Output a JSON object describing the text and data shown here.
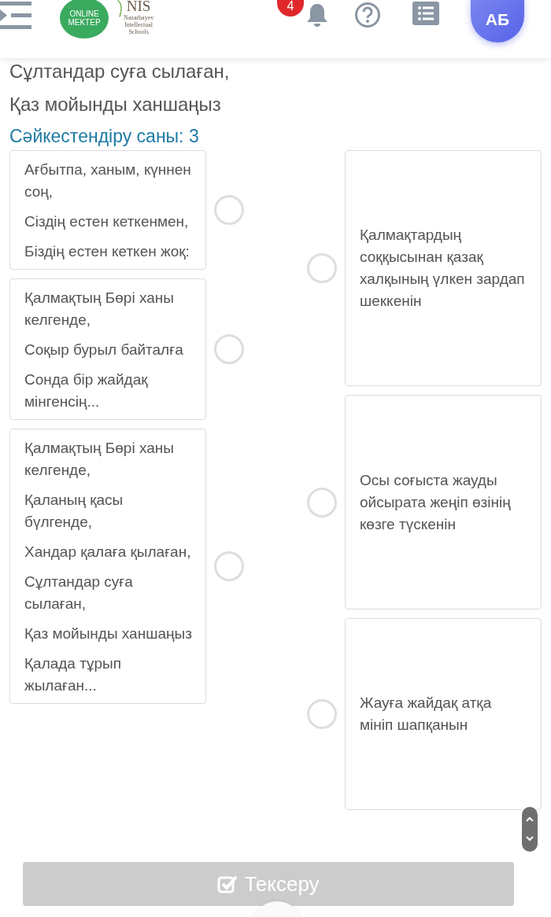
{
  "header": {
    "logo": {
      "line_1": "ONLINE",
      "line_2": "MEKTEP"
    },
    "school_logo": {
      "abbr": "NIS",
      "lines": [
        "Nazarbayev",
        "Intellectual",
        "Schools"
      ]
    },
    "notifications": {
      "count": "4"
    },
    "avatar": {
      "initials": "АБ"
    }
  },
  "question": {
    "lines": [
      "Сұлтандар суға сылаған,",
      "Қаз мойынды ханшаңыз"
    ]
  },
  "match_count": "Сәйкестендіру саны: 3",
  "left_items": [
    {
      "lines": [
        "Ағбытпа, ханым, күннен соң,",
        "Сіздің естен кеткенмен,",
        "Біздің естен кеткен жоқ:"
      ],
      "selected": false
    },
    {
      "lines": [
        "Қалмақтың Бөрі ханы келгенде,",
        "Соқыр бурыл байталға",
        "Сонда бір жайдақ мінгенсің..."
      ],
      "selected": false
    },
    {
      "lines": [
        "Қалмақтың Бөрі ханы келгенде,",
        "Қаланың қасы бүлгенде,",
        "Хандар қалаға қылаған,",
        "Сұлтандар суға сылаған,",
        "Қаз мойынды ханшаңыз",
        "Қалада тұрып жылаған..."
      ],
      "selected": false
    }
  ],
  "right_items": [
    {
      "text": "Қалмақтардың соққысынан қазақ халқының үлкен зардап шеккенін",
      "selected": false
    },
    {
      "text": "Осы соғыста жауды ойсырата жеңіп өзінің көзге түскенін",
      "selected": false
    },
    {
      "text": "Жауға жайдақ атқа мініп шапқанын",
      "selected": false
    }
  ],
  "submit_button": {
    "label": "Тексеру",
    "disabled": true
  }
}
